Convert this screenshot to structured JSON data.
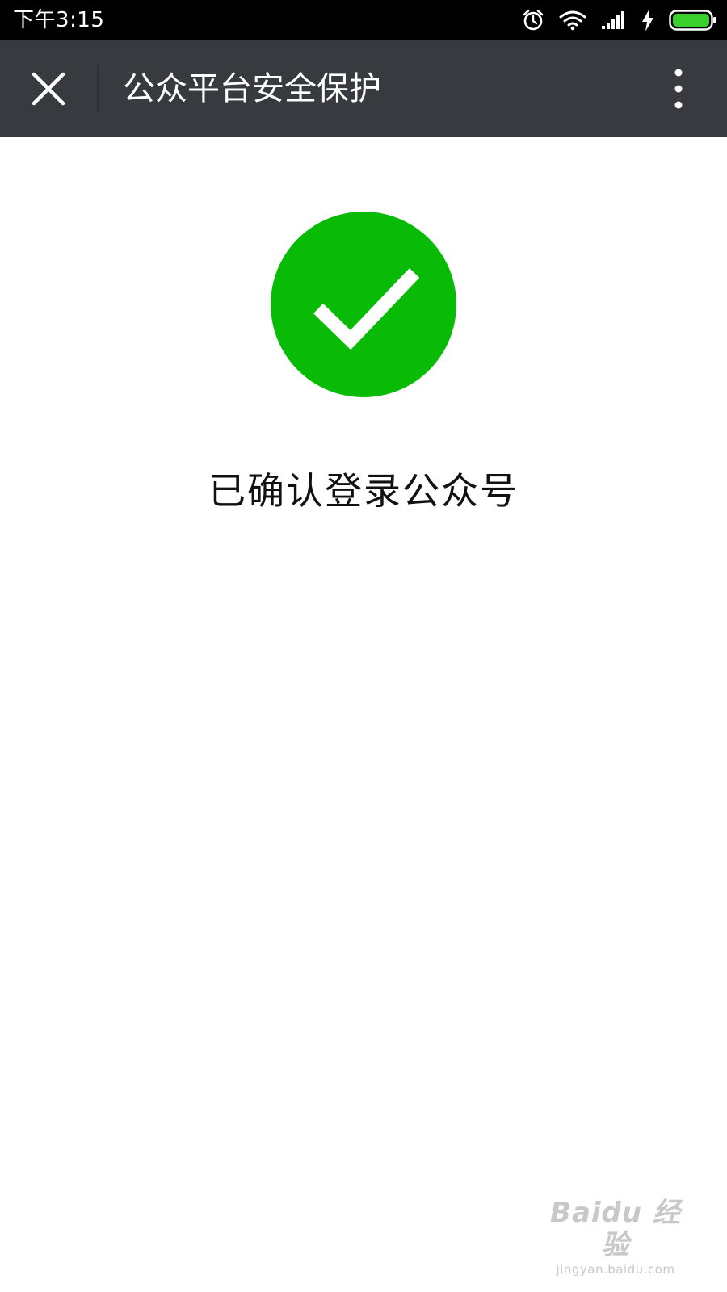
{
  "status_bar": {
    "time": "下午3:15",
    "icons": [
      "alarm-icon",
      "wifi-icon",
      "signal-icon",
      "charging-icon",
      "battery-icon"
    ]
  },
  "app_bar": {
    "title": "公众平台安全保护",
    "close_icon": "close-icon",
    "more_icon": "more-vertical-icon",
    "background_color": "#393a3f"
  },
  "main": {
    "success_icon": "check-circle-icon",
    "success_color": "#09bb07",
    "message": "已确认登录公众号"
  },
  "watermark": {
    "main": "Baidu 经验",
    "sub": "jingyan.baidu.com"
  }
}
